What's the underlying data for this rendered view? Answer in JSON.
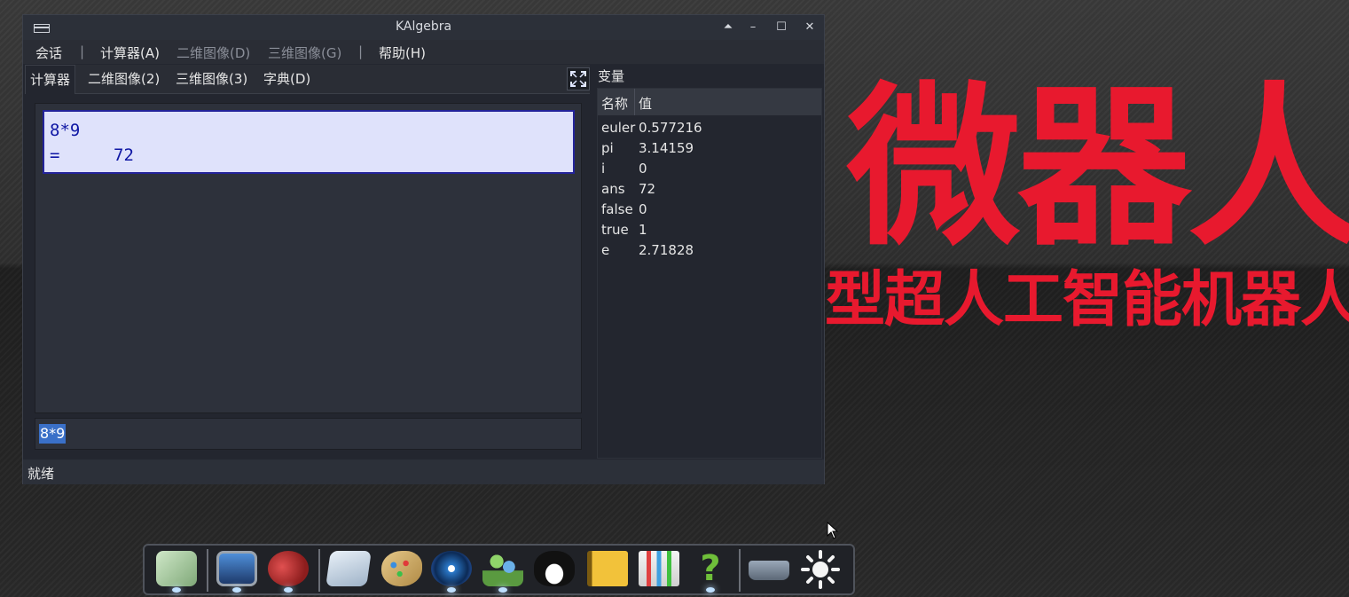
{
  "window": {
    "title": "KAlgebra",
    "controls": [
      "⏶",
      "–",
      "☐",
      "✕"
    ]
  },
  "menu": {
    "session": "会话",
    "calculator": "计算器(A)",
    "graph2d": "二维图像(D)",
    "graph3d": "三维图像(G)",
    "help": "帮助(H)",
    "separator": "|"
  },
  "tabs": [
    {
      "label": "计算器"
    },
    {
      "label": "二维图像(2)"
    },
    {
      "label": "三维图像(3)"
    },
    {
      "label": "字典(D)"
    }
  ],
  "console": {
    "expression": "8*9",
    "equals": "=",
    "result": "72"
  },
  "input": {
    "value": "8*9"
  },
  "variables": {
    "title": "变量",
    "col_name": "名称",
    "col_value": "值",
    "rows": [
      {
        "name": "euler",
        "value": "0.577216"
      },
      {
        "name": "pi",
        "value": "3.14159"
      },
      {
        "name": "i",
        "value": "0"
      },
      {
        "name": "ans",
        "value": "72"
      },
      {
        "name": "false",
        "value": "0"
      },
      {
        "name": "true",
        "value": "1"
      },
      {
        "name": "e",
        "value": "2.71828"
      }
    ]
  },
  "status": {
    "text": "就绪"
  },
  "desktop": {
    "brand_big": "微器人",
    "brand_sub": "型超人工智能机器人",
    "accent_color": "#e8192e"
  },
  "dock": {
    "items": [
      "browser-icon",
      "computer-icon",
      "hedgehog-icon",
      "notepad-icon",
      "paint-palette-icon",
      "media-player-icon",
      "users-icon",
      "penguin-icon",
      "notebook-icon",
      "chart-icon",
      "help-icon",
      "scanner-icon",
      "settings-sun-icon"
    ]
  }
}
